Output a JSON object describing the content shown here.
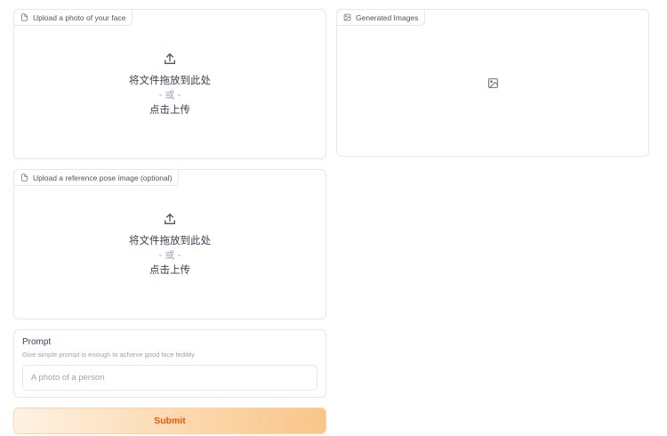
{
  "face_upload": {
    "label": "Upload a photo of your face",
    "drop_text": "将文件拖放到此处",
    "or_text": "- 或 -",
    "click_text": "点击上传",
    "label_icon": "file-icon",
    "upload_icon": "upload-icon"
  },
  "pose_upload": {
    "label": "Upload a reference pose image (optional)",
    "drop_text": "将文件拖放到此处",
    "or_text": "- 或 -",
    "click_text": "点击上传",
    "label_icon": "file-icon",
    "upload_icon": "upload-icon"
  },
  "gallery": {
    "label": "Generated Images",
    "label_icon": "image-icon",
    "placeholder_icon": "image-icon"
  },
  "prompt": {
    "title": "Prompt",
    "info": "Give simple prompt is enough to achieve good face fedility",
    "placeholder": "A photo of a person",
    "value": ""
  },
  "submit": {
    "label": "Submit",
    "color": "#ea580c"
  },
  "colors": {
    "accent": "#ea580c",
    "border": "#e5e7eb",
    "muted_text": "#9ca3af"
  }
}
